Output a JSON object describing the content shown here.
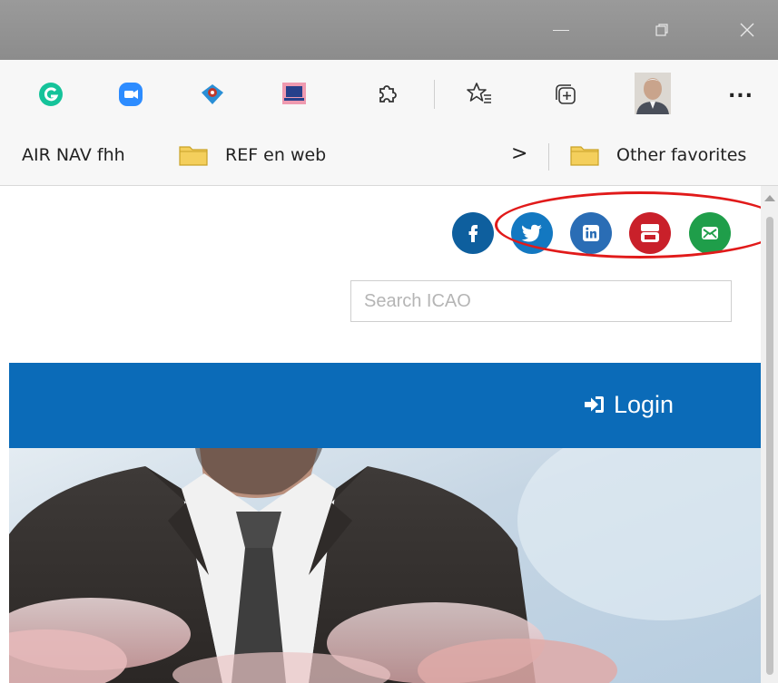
{
  "favorites_bar": {
    "items": [
      {
        "label": "AIR NAV fhh"
      },
      {
        "label": "REF en web"
      }
    ],
    "overflow_label": ">",
    "other_favorites": "Other favorites"
  },
  "toolbar": {
    "extensions": [
      "grammarly-icon",
      "zoom-icon",
      "map-pin-icon",
      "remote-desktop-icon",
      "puzzle-icon"
    ],
    "favorites_icon": "star-list-icon",
    "collections_icon": "collections-icon",
    "more_label": "..."
  },
  "page": {
    "social": [
      "facebook-icon",
      "twitter-icon",
      "linkedin-icon",
      "youtube-icon",
      "email-icon"
    ],
    "search": {
      "placeholder": "Search ICAO",
      "value": ""
    },
    "nav": {
      "login_label": "Login"
    }
  },
  "colors": {
    "nav_blue": "#0b6bb8",
    "facebook": "#0e5f9e",
    "twitter": "#1378c1",
    "linkedin": "#2a6db5",
    "youtube": "#c9202a",
    "email": "#1f9e4a",
    "highlight": "#e11a1a"
  }
}
